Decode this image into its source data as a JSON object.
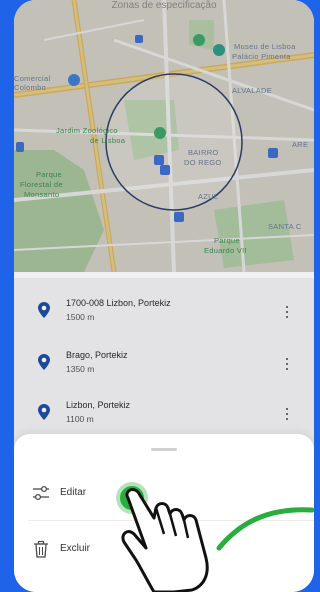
{
  "map": {
    "title": "Zonas de especificação",
    "labels": {
      "museu": "Museu de Lisboa",
      "palacio": "Palácio Pimenta",
      "comercial": "Comercial",
      "colombo": "Colombo",
      "alvalade": "ALVALADE",
      "jardim1": "Jardim Zoológico",
      "jardim2": "de Lisboa",
      "bairro1": "BAIRRO",
      "bairro2": "DO REGO",
      "are": "ARE",
      "parque1": "Parque",
      "parque2": "Florestal de",
      "parque3": "Monsanto",
      "azul": "AZUL",
      "santa": "SANTA C",
      "eduardo1": "Parque",
      "eduardo2": "Eduardo VII"
    }
  },
  "locations": [
    {
      "name": "1700-008 Lizbon, Portekiz",
      "distance": "1500 m"
    },
    {
      "name": "Brago, Portekiz",
      "distance": "1350 m"
    },
    {
      "name": "Lizbon, Portekiz",
      "distance": "1100 m"
    }
  ],
  "sheet": {
    "edit_label": "Editar",
    "delete_label": "Excluir"
  },
  "colors": {
    "background": "#1e63e8",
    "pin": "#1e4fa3",
    "tap": "#27ae3c"
  },
  "icons": {
    "edit": "sliders-icon",
    "delete": "trash-icon",
    "pin": "location-pin-icon",
    "more": "more-vertical-icon"
  }
}
